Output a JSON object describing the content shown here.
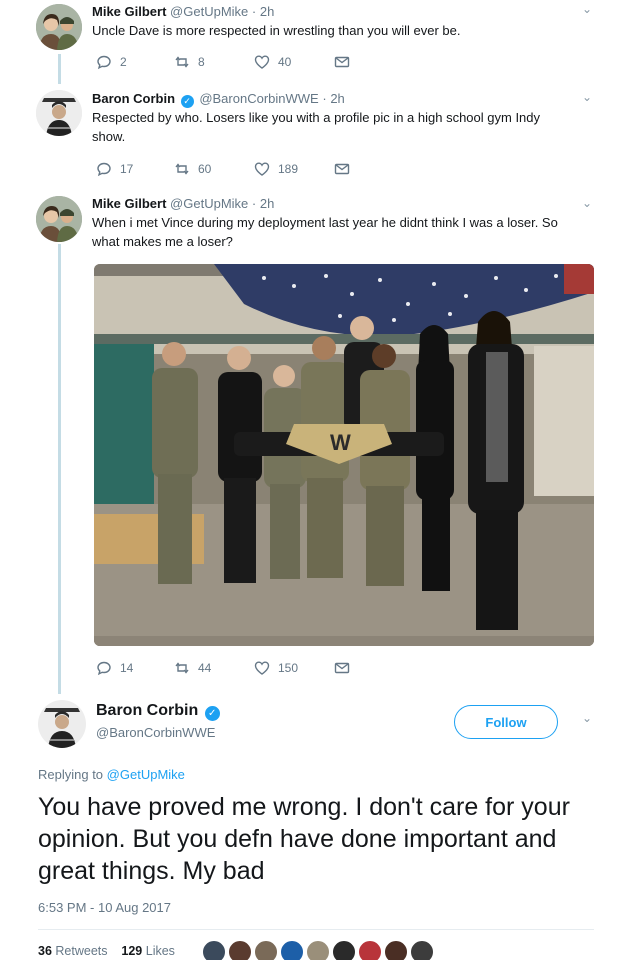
{
  "thread": [
    {
      "name": "Mike Gilbert",
      "verified": false,
      "handle": "@GetUpMike",
      "time": "2h",
      "text": "Uncle Dave is more respected in wrestling than you will ever be.",
      "replies": "2",
      "retweets": "8",
      "likes": "40"
    },
    {
      "name": "Baron Corbin",
      "verified": true,
      "handle": "@BaronCorbinWWE",
      "time": "2h",
      "text": "Respected by who. Losers like you with a profile pic in a high school gym Indy show.",
      "replies": "17",
      "retweets": "60",
      "likes": "189"
    },
    {
      "name": "Mike Gilbert",
      "verified": false,
      "handle": "@GetUpMike",
      "time": "2h",
      "text": "When i met Vince during my deployment last year he didnt think I was a loser. So what makes me a loser?",
      "replies": "14",
      "retweets": "44",
      "likes": "150"
    }
  ],
  "main_tweet": {
    "name": "Baron Corbin",
    "handle": "@BaronCorbinWWE",
    "follow_label": "Follow",
    "replying_prefix": "Replying to",
    "replying_to": "@GetUpMike",
    "text": "You have proved me wrong. I don't care for your opinion. But you defn have done important and great things. My bad",
    "timestamp": "6:53 PM - 10 Aug 2017",
    "retweets_count": "36",
    "retweets_label": "Retweets",
    "likes_count": "129",
    "likes_label": "Likes"
  },
  "ui": {
    "separator": "·",
    "verified_glyph": "✓",
    "chevron_glyph": "⌄"
  },
  "colors": {
    "accent": "#1da1f2",
    "muted": "#657786",
    "thread_line": "#c4dce5"
  }
}
